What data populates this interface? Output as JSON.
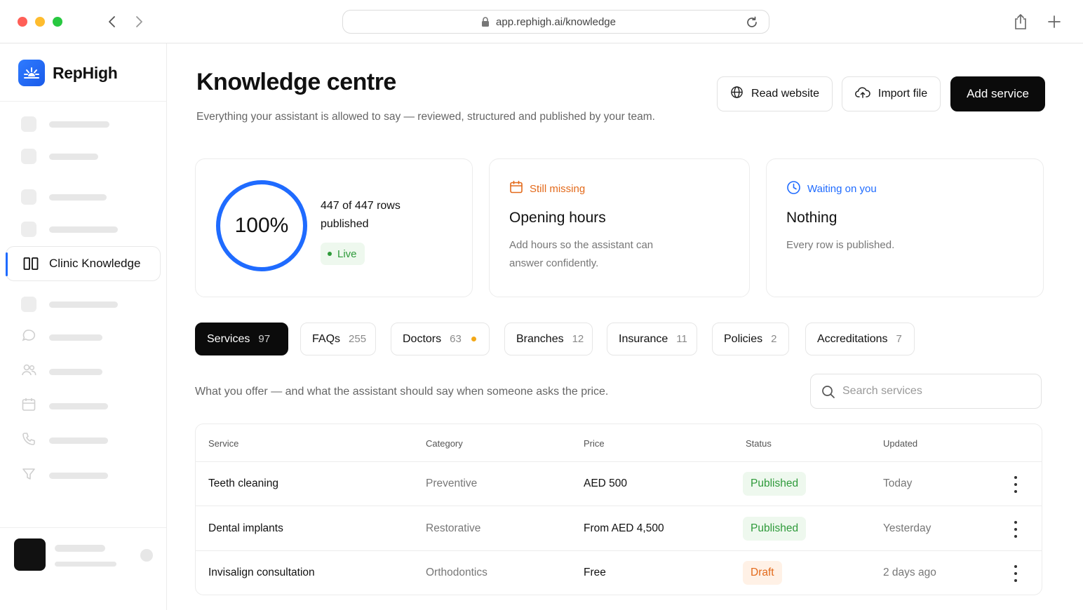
{
  "browser": {
    "url": "app.rephigh.ai/knowledge",
    "controls": {
      "close": "#ff5f57",
      "minimize": "#febc2e",
      "maximize": "#28c840"
    }
  },
  "sidebar": {
    "brand": "RepHigh",
    "active_item": {
      "label": "Clinic Knowledge",
      "icon": "book-icon"
    }
  },
  "header": {
    "title": "Knowledge centre",
    "subtitle": "Everything your assistant is allowed to say — reviewed, structured and published by your team.",
    "actions": {
      "read_website": "Read website",
      "import_file": "Import file",
      "add_service": "Add service"
    }
  },
  "summary": {
    "progress_percent": 100,
    "progress_label": "100%",
    "rows_text": "447 of 447 rows published",
    "live_label": "Live",
    "missing": {
      "kicker": "Still missing",
      "title": "Opening hours",
      "description": "Add hours so the assistant can answer confidently."
    },
    "waiting": {
      "kicker": "Waiting on you",
      "title": "Nothing",
      "description": "Every row is published."
    }
  },
  "tabs": [
    {
      "label": "Services",
      "count": "97",
      "active": true
    },
    {
      "label": "FAQs",
      "count": "255"
    },
    {
      "label": "Doctors",
      "count": "63",
      "warning": true
    },
    {
      "label": "Branches",
      "count": "12"
    },
    {
      "label": "Insurance",
      "count": "11"
    },
    {
      "label": "Policies",
      "count": "2"
    },
    {
      "label": "Accreditations",
      "count": "7"
    }
  ],
  "services": {
    "description": "What you offer — and what the assistant should say when someone asks the price.",
    "search_placeholder": "Search services",
    "columns": {
      "service": "Service",
      "category": "Category",
      "price": "Price",
      "status": "Status",
      "updated": "Updated"
    },
    "rows": [
      {
        "service": "Teeth cleaning",
        "category": "Preventive",
        "price": "AED 500",
        "status": "Published",
        "updated": "Today"
      },
      {
        "service": "Dental implants",
        "category": "Restorative",
        "price": "From AED 4,500",
        "status": "Published",
        "updated": "Yesterday"
      },
      {
        "service": "Invisalign consultation",
        "category": "Orthodontics",
        "price": "Free",
        "status": "Draft",
        "updated": "2 days ago"
      }
    ]
  },
  "colors": {
    "accent": "#1f6bff",
    "warning": "#e36a1b",
    "success": "#2e9a3a",
    "dark": "#0b0b0b"
  }
}
